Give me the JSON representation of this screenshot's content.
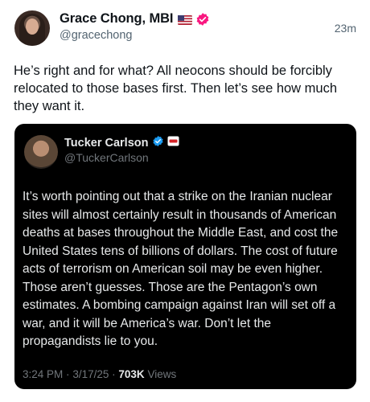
{
  "post": {
    "author_name": "Grace Chong, MBI",
    "author_handle": "@gracechong",
    "time_ago": "23m",
    "text": "He’s right and for what? All neocons should be forcibly relocated to those bases first. Then let’s see how much they want it.",
    "verified_badge_color": "#f91880"
  },
  "quoted_post": {
    "author_name": "Tucker Carlson",
    "author_handle": "@TuckerCarlson",
    "text": "It’s worth pointing out that a strike on the Iranian nuclear sites will almost certainly result in thousands of American deaths at bases throughout the Middle East, and cost the United States tens of billions of dollars. The cost of future acts of terrorism on American soil may be even higher. Those aren’t guesses. Those are the Pentagon’s own estimates. A bombing campaign against Iran will set off a war, and it will be America’s war. Don’t let the propagandists lie to you.",
    "time": "3:24 PM",
    "date": "3/17/25",
    "separator": "·",
    "views_count": "703K",
    "views_label": "Views",
    "verified_badge_color": "#1d9bf0"
  }
}
